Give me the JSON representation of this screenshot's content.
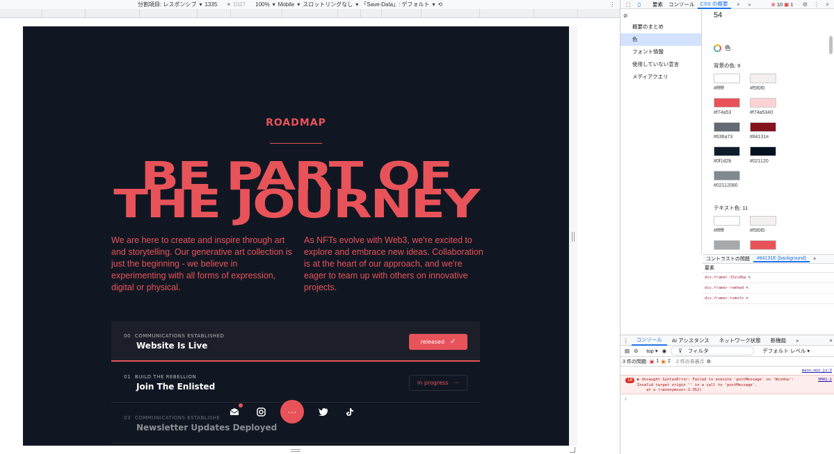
{
  "device_toolbar": {
    "dimensions_label": "分割項目: レスポンシブ",
    "width": "1335",
    "times": "×",
    "height": "1027",
    "zoom": "100%",
    "device": "Mobile",
    "throttle": "スロットリングなし",
    "save_data": "「Save-Data」: デフォルト"
  },
  "page": {
    "section_label": "ROADMAP",
    "headline_line1": "BE PART OF",
    "headline_line2": "THE JOURNEY",
    "intro_left": "We are here to create and inspire through art and storytelling. Our generative art collection is just the beginning - we believe in experimenting with all forms of expression, digital or physical.",
    "intro_right": "As NFTs evolve with Web3, we're excited to explore and embrace new ideas. Collaboration is at the heart of our approach, and we're eager to team up with others on innovative projects.",
    "roadmap": [
      {
        "index": "00",
        "category": "COMMUNICATIONS ESTABLISHED",
        "title": "Website Is Live",
        "status": "released"
      },
      {
        "index": "01",
        "category": "BUILD THE REBELLION",
        "title": "Join The Enlisted",
        "status": "in progress"
      },
      {
        "index": "03",
        "category": "COMMUNICATIONS ESTABLISHE",
        "title": "Newsletter Updates Deployed",
        "status": ""
      }
    ]
  },
  "devtools": {
    "tabs": {
      "elements": "要素",
      "console": "コンソール",
      "css_overview": "CSS の概要",
      "errors": "10",
      "warnings": "1"
    },
    "sidebar": [
      "概要のまとめ",
      "色",
      "フォント情報",
      "使用していない宣言",
      "メディアクエリ"
    ],
    "overview": {
      "top_count": "54",
      "colors_title": "色",
      "bg_title": "背景の色: 9",
      "bg_colors": [
        {
          "hex": "#ffffff",
          "swatch": "#ffffff"
        },
        {
          "hex": "#f5f0f0",
          "swatch": "#f5f0f0"
        },
        {
          "hex": "#f74a53",
          "swatch": "#f74a53"
        },
        {
          "hex": "#f74a5340",
          "swatch": "#fdd2d4"
        },
        {
          "hex": "#636a73",
          "swatch": "#636a73"
        },
        {
          "hex": "#84131e",
          "swatch": "#84131e"
        },
        {
          "hex": "#0f1d2b",
          "swatch": "#0f1d2b"
        },
        {
          "hex": "#021120",
          "swatch": "#021120"
        },
        {
          "hex": "#02112080",
          "swatch": "#808890"
        }
      ],
      "text_title": "テキスト色: 11",
      "text_colors": [
        {
          "hex": "#ffffff",
          "swatch": "#ffffff"
        },
        {
          "hex": "#f5f0f0",
          "swatch": "#f5f0f0"
        },
        {
          "hex": "",
          "swatch": "#a8a9ad"
        },
        {
          "hex": "",
          "swatch": "#e8535a"
        }
      ]
    },
    "contrast": {
      "tab1": "コントラストの問題",
      "tab2": "#84131E (background)",
      "header": "要素",
      "rows": [
        "div.framer-15zi0bp",
        "div.framer-remhwd",
        "div.framer-txmofx"
      ]
    },
    "console": {
      "tabs": [
        "コンソール",
        "AI アシスタンス",
        "ネットワーク状態",
        "新機能"
      ],
      "context": "top",
      "filter_placeholder": "フィルタ",
      "level": "デフォルト レベル",
      "issues_label": "3 件の問題:",
      "issues_errors": "1",
      "issues_warnings": "2",
      "hidden": "2 件の非表示",
      "link": "main.min.js:2",
      "error_count": "10",
      "error_msg": "Uncaught SyntaxError: Failed to execute 'postMessage' on 'Window': Invalid target origin '' in a call to 'postMessage'.\n    at u (<anonymous>:1:352)",
      "error_src": "VM41:1"
    }
  }
}
